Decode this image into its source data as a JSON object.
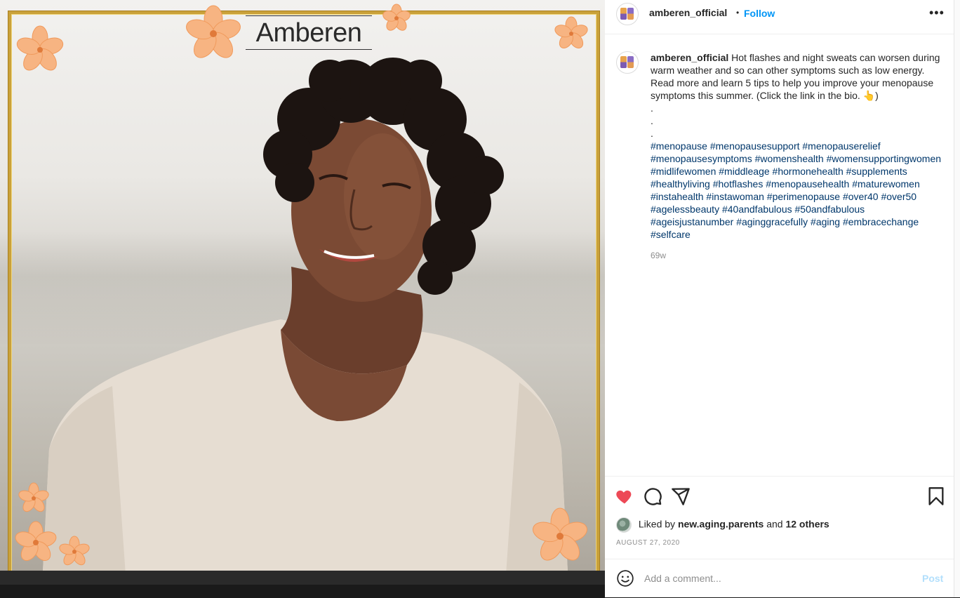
{
  "brand": {
    "logo_text": "Amberen"
  },
  "header": {
    "username": "amberen_official",
    "separator": "•",
    "follow_label": "Follow",
    "more_icon": "more-horizontal-icon",
    "more_label": "•••"
  },
  "caption": {
    "username": "amberen_official",
    "text": "Hot flashes and night sweats can worsen during warm weather and so can other symptoms such as low energy. Read more and learn 5 tips to help you improve your menopause symptoms this summer. (Click the link in the bio. 👆)",
    "dots": [
      ".",
      ".",
      "."
    ],
    "hashtags": [
      "#menopause",
      "#menopausesupport",
      "#menopauserelief",
      "#menopausesymptoms",
      "#womenshealth",
      "#womensupportingwomen",
      "#midlifewomen",
      "#middleage",
      "#hormonehealth",
      "#supplements",
      "#healthyliving",
      "#hotflashes",
      "#menopausehealth",
      "#maturewomen",
      "#instahealth",
      "#instawoman",
      "#perimenopause",
      "#over40",
      "#over50",
      "#agelessbeauty",
      "#40andfabulous",
      "#50andfabulous",
      "#ageisjustanumber",
      "#aginggracefully",
      "#aging",
      "#embracechange",
      "#selfcare"
    ],
    "time_ago": "69w"
  },
  "actions": {
    "like_icon": "heart-filled-icon",
    "comment_icon": "comment-icon",
    "share_icon": "share-icon",
    "save_icon": "bookmark-icon",
    "liked_prefix": "Liked by",
    "liked_user": "new.aging.parents",
    "liked_and": "and",
    "liked_others": "12 others",
    "date": "AUGUST 27, 2020"
  },
  "comment": {
    "placeholder": "Add a comment...",
    "post_label": "Post",
    "emoji_icon": "smiley-icon"
  },
  "colors": {
    "link_blue": "#0095f6",
    "hashtag_blue": "#00376b",
    "like_red": "#ed4956",
    "gold_frame": "#c9a13a",
    "flower_peach": "#f7b482"
  }
}
